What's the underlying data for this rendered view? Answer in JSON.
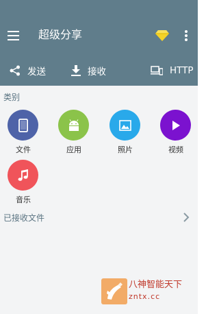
{
  "app": {
    "title": "超级分享"
  },
  "tabs": [
    {
      "label": "发送",
      "icon": "share-icon"
    },
    {
      "label": "接收",
      "icon": "download-icon"
    },
    {
      "label": "HTTP",
      "icon": "devices-icon"
    }
  ],
  "categories": {
    "heading": "类别",
    "items": [
      {
        "label": "文件",
        "icon": "phone-icon",
        "color": "#4e63a8"
      },
      {
        "label": "应用",
        "icon": "android-icon",
        "color": "#8bc34a"
      },
      {
        "label": "照片",
        "icon": "photo-icon",
        "color": "#29a9ea"
      },
      {
        "label": "视频",
        "icon": "play-icon",
        "color": "#7b12cf"
      },
      {
        "label": "音乐",
        "icon": "music-note-icon",
        "color": "#f0545a"
      }
    ]
  },
  "received": {
    "label": "已接收文件"
  },
  "watermark": {
    "title": "八神智能天下",
    "url": "zntx.cc"
  },
  "colors": {
    "appbar": "#607d8b",
    "background": "#f3f4f5",
    "section_text": "#5b7482",
    "diamond": "#f5d327"
  }
}
